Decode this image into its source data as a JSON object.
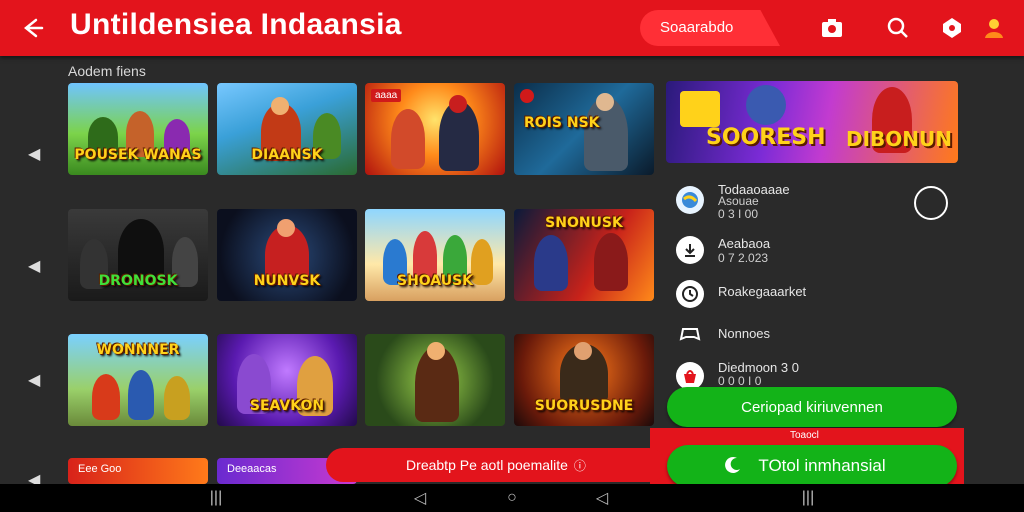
{
  "header": {
    "title": "Untildensiea Indaansia",
    "search_label": "Soaarabdo",
    "icons": [
      "back-arrow-icon",
      "camera-icon",
      "search-icon",
      "location-icon",
      "profile-icon"
    ]
  },
  "section_label": "Aodem fiens",
  "tiles": [
    {
      "title": "POUSEK WANAS",
      "badge": ""
    },
    {
      "title": "DIAANSK",
      "badge": ""
    },
    {
      "title": "",
      "badge": "aaaa"
    },
    {
      "title": "ROIS NSK",
      "badge": ""
    },
    {
      "title": "DRONOSK",
      "badge": ""
    },
    {
      "title": "NUNVSK",
      "badge": ""
    },
    {
      "title": "SHOAUSK",
      "badge": ""
    },
    {
      "title": "SNONUSK",
      "badge": ""
    },
    {
      "title": "WONNNER",
      "badge": ""
    },
    {
      "title": "SEAVKON",
      "badge": ""
    },
    {
      "title": "",
      "badge": ""
    },
    {
      "title": "SUORUSDNE",
      "badge": ""
    },
    {
      "title": "",
      "badge": "Eee   Goo"
    },
    {
      "title": "",
      "badge": "Deeaacas"
    }
  ],
  "featured": {
    "left_title": "SOORESH",
    "right_title": "DIBONUN"
  },
  "list": [
    {
      "label": "Todaaoaaae",
      "sub1": "Asouae",
      "sub2": "0 3 I 00"
    },
    {
      "label": "Aeabaoa",
      "sub1": "0 7 2.023",
      "sub2": ""
    },
    {
      "label": "Roakegaaarket",
      "sub1": "",
      "sub2": ""
    },
    {
      "label": "Nonnoes",
      "sub1": "",
      "sub2": ""
    },
    {
      "label": "Diedmoon 3 0",
      "sub1": "0 0 0 I 0",
      "sub2": ""
    }
  ],
  "buttons": {
    "primary": "Ceriopad kiriuvennen",
    "secondary": "TOtol inmhansial",
    "banner": "Dreabtp Pe aotl poemalite",
    "panel_label": "Toaocl"
  },
  "colors": {
    "brand_red": "#e3141c",
    "green": "#13b318",
    "bg": "#2a2a2a"
  }
}
